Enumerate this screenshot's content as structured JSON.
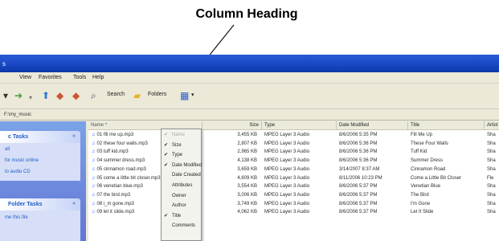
{
  "annotation": {
    "title": "Column Heading"
  },
  "window": {
    "title_fragment": "s",
    "menu": [
      "View",
      "Favorites",
      "Tools",
      "Help"
    ],
    "toolbar": {
      "search_label": "Search",
      "folders_label": "Folders"
    },
    "address": "F:\\my_music"
  },
  "tasks": {
    "music_tasks": {
      "title": "c Tasks",
      "items": [
        "all",
        "for music online",
        "to audio CD"
      ]
    },
    "folder_tasks": {
      "title": "Folder Tasks",
      "items": [
        "me this file"
      ]
    }
  },
  "columns": [
    "Name",
    "Size",
    "Type",
    "Date Modified",
    "Title",
    "Artist"
  ],
  "rows": [
    {
      "name": "01 fill me up.mp3",
      "size": "3,455 KB",
      "type": "MPEG Layer 3 Audio",
      "date": "8/6/2006 5:35 PM",
      "title": "Fill Me Up",
      "artist": "Sha"
    },
    {
      "name": "02 these four walls.mp3",
      "size": "2,807 KB",
      "type": "MPEG Layer 3 Audio",
      "date": "8/6/2006 5:36 PM",
      "title": "These Four Walls",
      "artist": "Sha"
    },
    {
      "name": "03 tuff kid.mp3",
      "size": "2,965 KB",
      "type": "MPEG Layer 3 Audio",
      "date": "8/6/2006 5:36 PM",
      "title": "Tuff Kid",
      "artist": "Sha"
    },
    {
      "name": "04 summer dress.mp3",
      "size": "4,138 KB",
      "type": "MPEG Layer 3 Audio",
      "date": "8/6/2006 5:36 PM",
      "title": "Summer Dress",
      "artist": "Sha"
    },
    {
      "name": "05 cinnamon road.mp3",
      "size": "3,659 KB",
      "type": "MPEG Layer 3 Audio",
      "date": "3/14/2007 8:37 AM",
      "title": "Cinnamon Road",
      "artist": "Sha"
    },
    {
      "name": "05 come a little bit closer.mp3",
      "size": "4,609 KB",
      "type": "MPEG Layer 3 Audio",
      "date": "8/11/2006 10:23 PM",
      "title": "Come a Little Bit Closer",
      "artist": "Fle"
    },
    {
      "name": "06 venetian blue.mp3",
      "size": "3,554 KB",
      "type": "MPEG Layer 3 Audio",
      "date": "8/6/2006 5:37 PM",
      "title": "Venetian Blue",
      "artist": "Sha"
    },
    {
      "name": "07 the bird.mp3",
      "size": "3,006 KB",
      "type": "MPEG Layer 3 Audio",
      "date": "8/6/2006 5:37 PM",
      "title": "The Bird",
      "artist": "Sha"
    },
    {
      "name": "08 i_m gone.mp3",
      "size": "3,749 KB",
      "type": "MPEG Layer 3 Audio",
      "date": "8/6/2006 5:37 PM",
      "title": "I'm Gone",
      "artist": "Sha"
    },
    {
      "name": "09 let it slide.mp3",
      "size": "4,062 KB",
      "type": "MPEG Layer 3 Audio",
      "date": "8/6/2006 5:37 PM",
      "title": "Let It Slide",
      "artist": "Sha"
    }
  ],
  "context_menu": [
    {
      "label": "Name",
      "checked": true,
      "disabled": true
    },
    {
      "label": "Size",
      "checked": true,
      "disabled": false
    },
    {
      "label": "Type",
      "checked": true,
      "disabled": false
    },
    {
      "label": "Date Modified",
      "checked": true,
      "disabled": false
    },
    {
      "label": "Date Created",
      "checked": false,
      "disabled": false
    },
    {
      "label": "Attributes",
      "checked": false,
      "disabled": false
    },
    {
      "label": "Owner",
      "checked": false,
      "disabled": false
    },
    {
      "label": "Author",
      "checked": false,
      "disabled": false
    },
    {
      "label": "Title",
      "checked": true,
      "disabled": false
    },
    {
      "label": "Comments",
      "checked": false,
      "disabled": false
    }
  ],
  "colors": {
    "titlebar": "#1846c2",
    "taskpane": "#6f8ee0",
    "link": "#215dc6",
    "header": "#ebeadb"
  }
}
